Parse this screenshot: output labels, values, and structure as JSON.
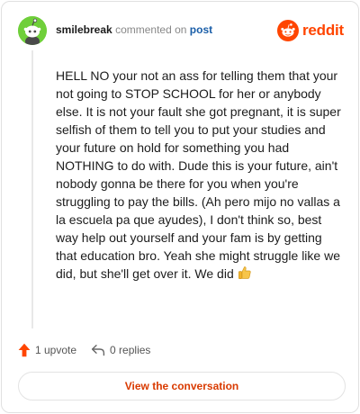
{
  "header": {
    "username": "smilebreak",
    "action_text": "commented on",
    "post_link": "post",
    "brand": "reddit"
  },
  "comment": {
    "text": "HELL NO your not an ass for telling them that your not going to STOP SCHOOL for her or anybody else. It is not your fault she got pregnant, it is super selfish of them to tell you to put your studies and your future on hold for something you had NOTHING to do with. Dude this is your future, ain't nobody gonna be there for you when you're struggling to pay the bills. (Ah pero mijo no vallas a la escuela pa que ayudes), I don't think so, best way help out yourself and your fam is by getting that education bro. Yeah she might struggle like we did, but she'll get over it. We did",
    "emoji": "thumbs-up-icon"
  },
  "actions": {
    "upvotes": "1 upvote",
    "replies": "0 replies"
  },
  "footer": {
    "view_label": "View the conversation"
  },
  "colors": {
    "brand": "#ff4500",
    "link": "#1a5ea8",
    "avatar": "#6fcf3a",
    "button_text": "#d93a00"
  }
}
